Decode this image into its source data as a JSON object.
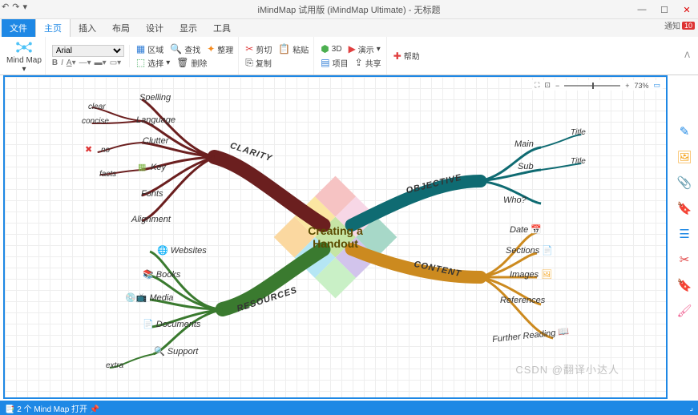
{
  "window": {
    "title": "iMindMap 试用版 (iMindMap Ultimate) - 无标题",
    "notice_label": "通知",
    "notice_count": "10"
  },
  "tabs": {
    "file": "文件",
    "home": "主页",
    "insert": "插入",
    "layout": "布局",
    "design": "设计",
    "display": "显示",
    "tools": "工具"
  },
  "ribbon": {
    "mindmap_label": "Mind Map",
    "font": "Arial",
    "area": "区域",
    "find": "查找",
    "arrange": "整理",
    "select": "选择",
    "delete": "删除",
    "cut": "剪切",
    "paste": "粘贴",
    "copy": "复制",
    "threeD": "3D",
    "present": "演示",
    "project": "项目",
    "share": "共享",
    "help": "帮助"
  },
  "zoom": {
    "value": "73%"
  },
  "mindmap": {
    "central": "Creating a Handout",
    "branches": {
      "clarity": {
        "label": "CLARITY",
        "nodes": [
          {
            "text": "Spelling"
          },
          {
            "text": "Language",
            "sub": [
              "clear",
              "concise"
            ]
          },
          {
            "text": "Clutter",
            "sub": [
              "no"
            ]
          },
          {
            "text": "Key",
            "sub": [
              "facts"
            ]
          },
          {
            "text": "Fonts"
          },
          {
            "text": "Alignment"
          }
        ]
      },
      "resources": {
        "label": "RESOURCES",
        "nodes": [
          {
            "text": "Websites",
            "icon": "🌐"
          },
          {
            "text": "Books",
            "icon": "📚"
          },
          {
            "text": "Media",
            "icon": "💿📺"
          },
          {
            "text": "Documents",
            "icon": "📄"
          },
          {
            "text": "Support",
            "icon": "🔍",
            "sub": [
              "extra"
            ]
          }
        ]
      },
      "objective": {
        "label": "OBJECTIVE",
        "nodes": [
          {
            "text": "Main",
            "sub": [
              "Title"
            ]
          },
          {
            "text": "Sub",
            "sub": [
              "Title"
            ]
          },
          {
            "text": "Who?"
          }
        ]
      },
      "content": {
        "label": "CONTENT",
        "nodes": [
          {
            "text": "Date",
            "icon": "📅"
          },
          {
            "text": "Sections",
            "icon": "📄"
          },
          {
            "text": "Images",
            "icon": "🖼"
          },
          {
            "text": "References"
          },
          {
            "text": "Further Reading",
            "icon": "📖"
          }
        ]
      }
    }
  },
  "status": {
    "left": "📑 2 个 Mind Map 打开  📌"
  },
  "watermark": "CSDN @翻译小达人"
}
